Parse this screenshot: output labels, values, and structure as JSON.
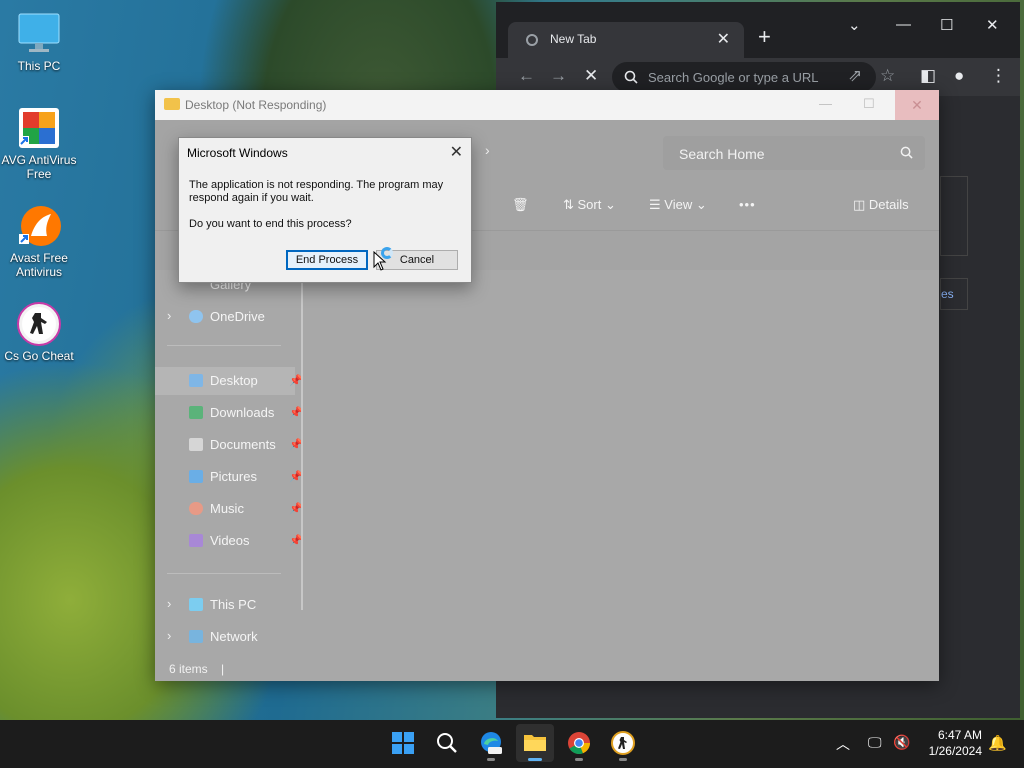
{
  "desktop": {
    "icons": [
      {
        "label": "This PC",
        "icon": "this-pc-icon"
      },
      {
        "label": "AVG AntiVirus Free",
        "icon": "avg-antivirus-icon"
      },
      {
        "label": "Avast Free Antivirus",
        "icon": "avast-icon"
      },
      {
        "label": "Cs Go Cheat",
        "icon": "csgo-cheat-icon"
      }
    ]
  },
  "chrome": {
    "tab_title": "New Tab",
    "omnibox_placeholder": "Search Google or type a URL",
    "side_link_fragment": "es"
  },
  "explorer": {
    "title": "Desktop (Not Responding)",
    "search_placeholder": "Search Home",
    "toolbar": {
      "sort_label": "Sort",
      "view_label": "View",
      "more_label": "•••",
      "details_label": "Details"
    },
    "nav": {
      "gallery": "Gallery",
      "onedrive": "OneDrive",
      "pinned": [
        {
          "label": "Desktop",
          "icon": "desktop-folder-icon",
          "color": "#7fb6e6"
        },
        {
          "label": "Downloads",
          "icon": "downloads-icon",
          "color": "#5bb37a"
        },
        {
          "label": "Documents",
          "icon": "documents-icon",
          "color": "#cfcfcf"
        },
        {
          "label": "Pictures",
          "icon": "pictures-icon",
          "color": "#6aaee6"
        },
        {
          "label": "Music",
          "icon": "music-icon",
          "color": "#e79a86"
        },
        {
          "label": "Videos",
          "icon": "videos-icon",
          "color": "#a888d6"
        }
      ],
      "this_pc": "This PC",
      "network": "Network"
    },
    "status": "6 items"
  },
  "dialog": {
    "title": "Microsoft Windows",
    "message": "The application is not responding. The program may respond again if you wait.",
    "question": "Do you want to end this process?",
    "end_button": "End Process",
    "cancel_button": "Cancel"
  },
  "taskbar": {
    "time": "6:47 AM",
    "date": "1/26/2024",
    "apps": [
      "start-icon",
      "search-icon",
      "edge-pre-icon",
      "file-explorer-icon",
      "chrome-icon",
      "csgo-cheat-icon"
    ]
  },
  "colors": {
    "accent": "#0067c0",
    "taskbar": "#1c1c1c",
    "chrome_dark": "#202124"
  }
}
